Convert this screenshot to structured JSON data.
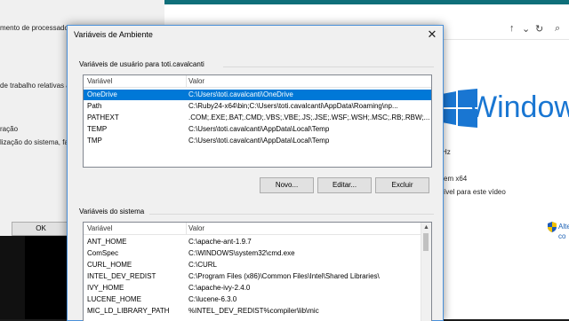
{
  "background_left": {
    "fragments": [
      "mento de processador",
      "de trabalho relativas à",
      "ração",
      "lização do sistema, fa"
    ],
    "ok_label": "OK"
  },
  "background_right": {
    "windows_text": "Window",
    "fragments": [
      "Hz",
      "em x64",
      "ível para este vídeo"
    ],
    "alt_link_line1": "Alte",
    "alt_link_line2": "co"
  },
  "dialog": {
    "title": "Variáveis de Ambiente",
    "user_group": {
      "label": "Variáveis de usuário para toti.cavalcanti",
      "col_var": "Variável",
      "col_val": "Valor",
      "rows": [
        {
          "var": "OneDrive",
          "val": "C:\\Users\\toti.cavalcanti\\OneDrive",
          "selected": true
        },
        {
          "var": "Path",
          "val": "C:\\Ruby24-x64\\bin;C:\\Users\\toti.cavalcanti\\AppData\\Roaming\\np..."
        },
        {
          "var": "PATHEXT",
          "val": ".COM;.EXE;.BAT;.CMD;.VBS;.VBE;.JS;.JSE;.WSF;.WSH;.MSC;.RB;.RBW;..."
        },
        {
          "var": "TEMP",
          "val": "C:\\Users\\toti.cavalcanti\\AppData\\Local\\Temp"
        },
        {
          "var": "TMP",
          "val": "C:\\Users\\toti.cavalcanti\\AppData\\Local\\Temp"
        }
      ],
      "new_label": "Novo...",
      "edit_label": "Editar...",
      "delete_label": "Excluir"
    },
    "system_group": {
      "label": "Variáveis do sistema",
      "col_var": "Variável",
      "col_val": "Valor",
      "rows": [
        {
          "var": "ANT_HOME",
          "val": "C:\\apache-ant-1.9.7"
        },
        {
          "var": "ComSpec",
          "val": "C:\\WINDOWS\\system32\\cmd.exe"
        },
        {
          "var": "CURL_HOME",
          "val": "C:\\CURL"
        },
        {
          "var": "INTEL_DEV_REDIST",
          "val": "C:\\Program Files (x86)\\Common Files\\Intel\\Shared Libraries\\"
        },
        {
          "var": "IVY_HOME",
          "val": "C:\\apache-ivy-2.4.0"
        },
        {
          "var": "LUCENE_HOME",
          "val": "C:\\lucene-6.3.0"
        },
        {
          "var": "MIC_LD_LIBRARY_PATH",
          "val": "%INTEL_DEV_REDIST%compiler\\lib\\mic"
        }
      ]
    }
  },
  "colors": {
    "selection": "#0078d7",
    "accent": "#1976d2"
  }
}
